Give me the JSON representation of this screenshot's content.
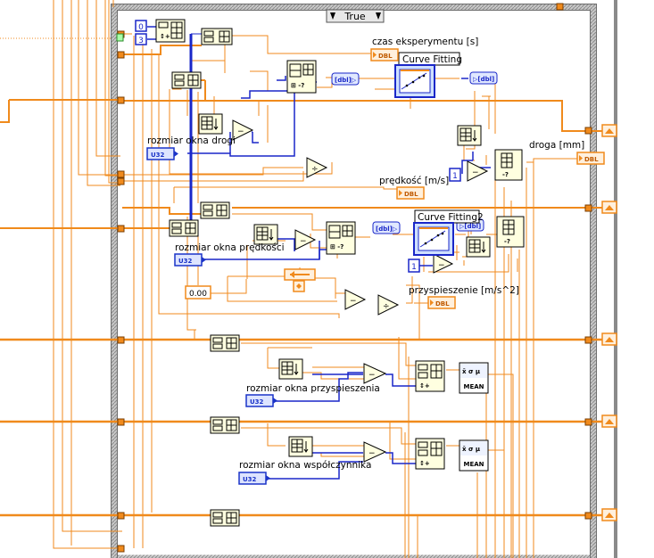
{
  "case_structure": {
    "selector_value": "True"
  },
  "indicators": {
    "czas": {
      "label": "czas eksperymentu [s]",
      "type": "DBL"
    },
    "droga": {
      "label": "droga [mm]",
      "type": "DBL"
    },
    "predkosc": {
      "label": "prędkość [m/s]",
      "type": "DBL"
    },
    "przyspieszenie": {
      "label": "przyspieszenie [m/s^2]",
      "type": "DBL"
    }
  },
  "controls": {
    "okno_drogi": {
      "label": "rozmiar okna drogi",
      "type": "U32"
    },
    "okno_predkosci": {
      "label": "rozmiar okna prędkości",
      "type": "U32"
    },
    "okno_przyspieszenia": {
      "label": "rozmiar okna przyspieszenia",
      "type": "U32"
    },
    "okno_wspolczynnika": {
      "label": "rozmiar okna współczynnika",
      "type": "U32"
    }
  },
  "express_vis": {
    "curve1": {
      "label": "Curve Fitting"
    },
    "curve2": {
      "label": "Curve Fitting2"
    }
  },
  "constants": {
    "index_a": "0",
    "index_b": "3",
    "one_a": "1",
    "one_b": "1",
    "zero_float": "0.00"
  },
  "mean_vis": {
    "label": "MEAN",
    "glyph": "x̄ σ μ"
  },
  "colors": {
    "orange_wire": "#f08a1c",
    "blue_wire": "#1a27c8",
    "node_bg": "#ffffe0",
    "terminal_bg": "#fff0dd",
    "control_blue": "#1a33c8",
    "frame_gray": "#8a8a8a"
  }
}
